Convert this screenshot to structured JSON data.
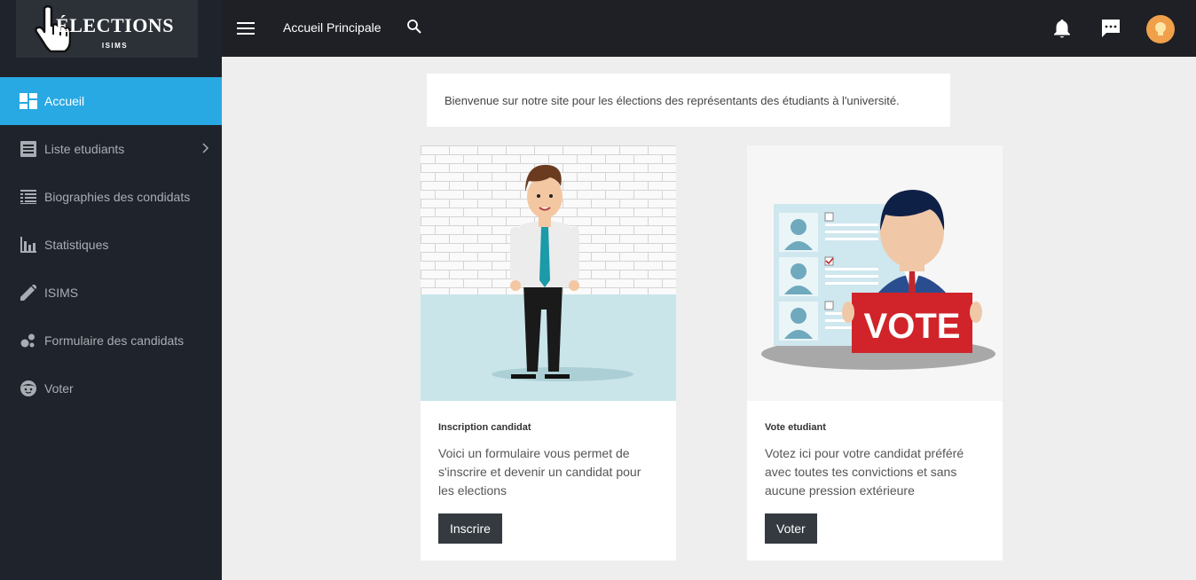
{
  "brand": {
    "title": "ÉLECTIONS",
    "subtitle": "ISIMS"
  },
  "sidebar": {
    "items": [
      {
        "label": "Accueil",
        "icon": "dashboard-icon",
        "active": true
      },
      {
        "label": "Liste etudiants",
        "icon": "list-icon",
        "has_submenu": true
      },
      {
        "label": "Biographies des condidats",
        "icon": "grid-list-icon"
      },
      {
        "label": "Statistiques",
        "icon": "bar-chart-icon"
      },
      {
        "label": "ISIMS",
        "icon": "pencil-icon"
      },
      {
        "label": "Formulaire des candidats",
        "icon": "bubbles-icon"
      },
      {
        "label": "Voter",
        "icon": "face-icon"
      }
    ]
  },
  "topbar": {
    "title": "Accueil Principale"
  },
  "welcome": {
    "text": "Bienvenue sur notre site pour les élections des représentants des étudiants à l'université."
  },
  "cards": [
    {
      "title": "Inscription candidat",
      "text": "Voici un formulaire vous permet de s'inscrire et devenir un candidat pour les elections",
      "button": "Inscrire"
    },
    {
      "title": "Vote etudiant",
      "text": "Votez ici pour votre candidat préféré avec toutes tes convictions et sans aucune pression extérieure",
      "button": "Voter",
      "sign": "VOTE"
    }
  ],
  "colors": {
    "sidebar_bg": "#1f242c",
    "active": "#29a9e3",
    "topbar_bg": "#1f2025",
    "button": "#343a40"
  }
}
